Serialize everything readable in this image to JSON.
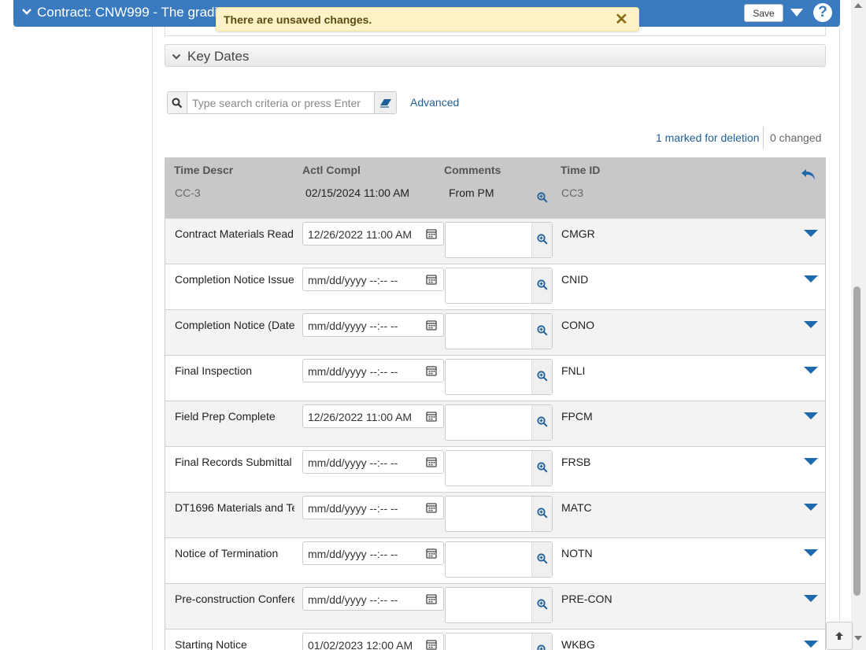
{
  "header": {
    "title": "Contract: CNW999 - The gradi",
    "save_label": "Save",
    "help_label": "?"
  },
  "notification": {
    "message": "There are unsaved changes.",
    "close_label": "✕"
  },
  "section": {
    "title": "Key Dates"
  },
  "search": {
    "placeholder": "Type search criteria or press Enter",
    "value": "",
    "advanced_label": "Advanced"
  },
  "status": {
    "marked": "1 marked for deletion",
    "changed": "0 changed"
  },
  "grid": {
    "columns": {
      "time_descr": "Time Descr",
      "actl_compl": "Actl Compl",
      "comments": "Comments",
      "time_id": "Time ID"
    },
    "deleted_row": {
      "time_descr": "CC-3",
      "actl_compl": "02/15/2024 11:00 AM",
      "comments": "From PM",
      "time_id": "CC3"
    },
    "rows": [
      {
        "time_descr": "Contract Materials Read",
        "actl_compl": "12/26/2022 11:00  AM",
        "time_id": "CMGR"
      },
      {
        "time_descr": "Completion Notice Issue",
        "actl_compl": "mm/dd/yyyy --:-- --",
        "time_id": "CNID"
      },
      {
        "time_descr": "Completion Notice (Date",
        "actl_compl": "mm/dd/yyyy --:-- --",
        "time_id": "CONO"
      },
      {
        "time_descr": "Final Inspection",
        "actl_compl": "mm/dd/yyyy --:-- --",
        "time_id": "FNLI"
      },
      {
        "time_descr": "Field Prep Complete",
        "actl_compl": "12/26/2022 11:00  AM",
        "time_id": "FPCM"
      },
      {
        "time_descr": "Final Records Submittal",
        "actl_compl": "mm/dd/yyyy --:-- --",
        "time_id": "FRSB"
      },
      {
        "time_descr": "DT1696 Materials and Te",
        "actl_compl": "mm/dd/yyyy --:-- --",
        "time_id": "MATC"
      },
      {
        "time_descr": "Notice of Termination",
        "actl_compl": "mm/dd/yyyy --:-- --",
        "time_id": "NOTN"
      },
      {
        "time_descr": "Pre-construction Confere",
        "actl_compl": "mm/dd/yyyy --:-- --",
        "time_id": "PRE-CON"
      },
      {
        "time_descr": "Starting Notice",
        "actl_compl": "01/02/2023 12:00  AM",
        "time_id": "WKBG"
      }
    ]
  },
  "icons": {
    "header_chevron": "chevron-down-icon",
    "search": "search-icon",
    "eraser": "eraser-icon",
    "undo": "undo-icon",
    "zoom": "zoom-in-icon",
    "calendar": "calendar-icon",
    "row_menu": "caret-down-icon",
    "scroll_top": "arrow-up-icon"
  },
  "colors": {
    "header_bg": "#3a7bbf",
    "notice_bg": "#fdf3c6",
    "link": "#1f5f99",
    "deleted_row_bg": "#c8c8c8",
    "caret": "#1f6aad"
  }
}
